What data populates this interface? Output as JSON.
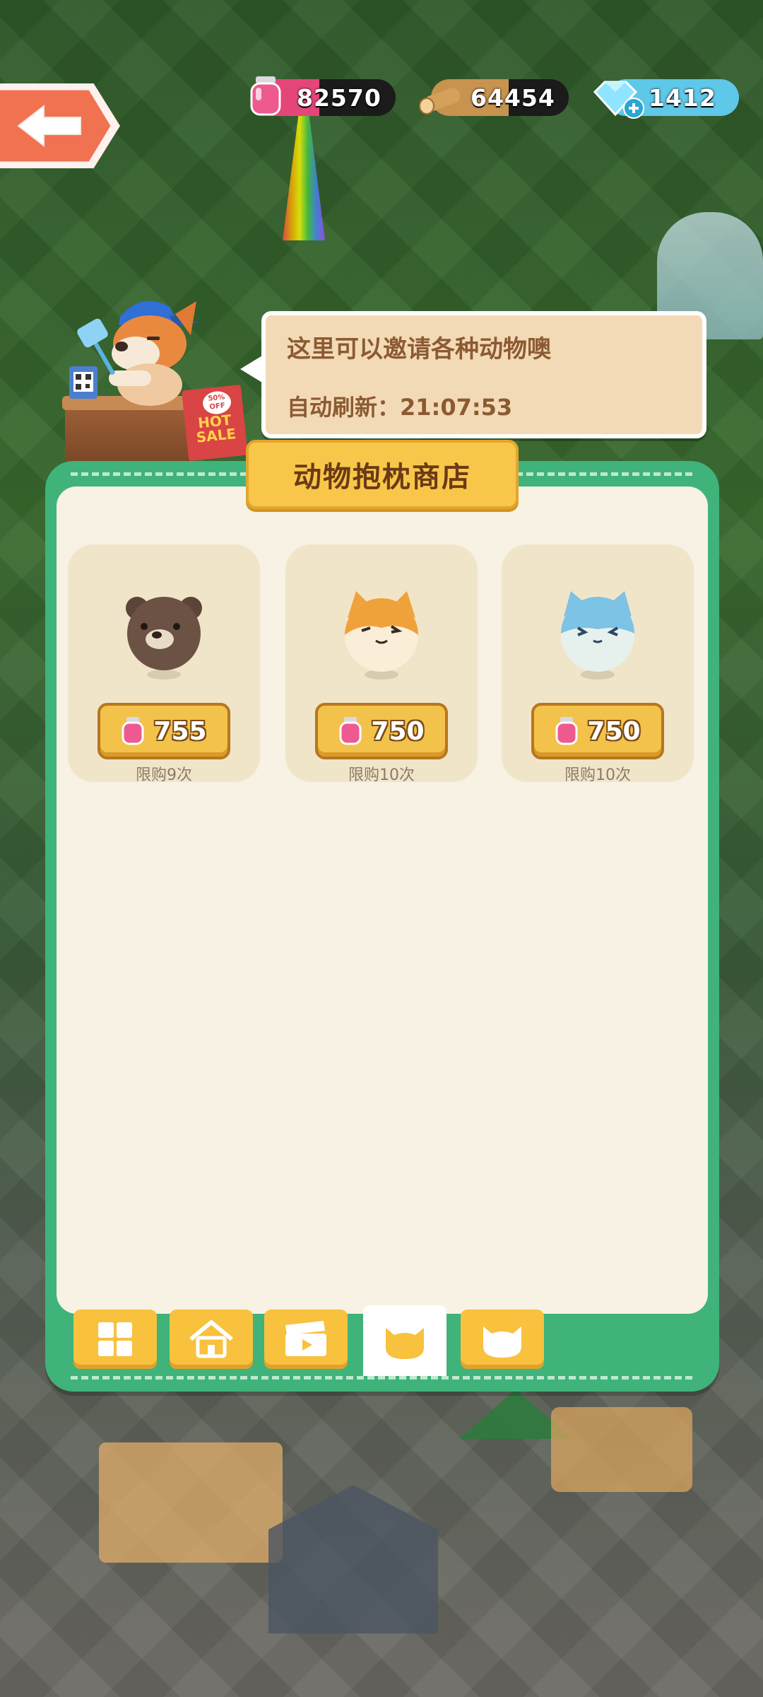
{
  "resources": {
    "ink": "82570",
    "wood": "64454",
    "gems": "1412"
  },
  "npc": {
    "sale_badge": "50% OFF",
    "sale_sign_line1": "HOT",
    "sale_sign_line2": "SALE"
  },
  "bubble": {
    "message": "这里可以邀请各种动物噢",
    "refresh_label": "自动刷新：21:07:53"
  },
  "shop": {
    "title": "动物抱枕商店",
    "items": [
      {
        "pillow": "bear-pillow",
        "price": "755",
        "limit": "限购9次"
      },
      {
        "pillow": "shiba-pillow",
        "price": "750",
        "limit": "限购10次"
      },
      {
        "pillow": "blue-cat-pillow",
        "price": "750",
        "limit": "限购10次"
      }
    ]
  },
  "tabs": [
    {
      "icon": "grid-icon",
      "active": false
    },
    {
      "icon": "house-icon",
      "active": false
    },
    {
      "icon": "clapperboard-icon",
      "active": false
    },
    {
      "icon": "cat-face-icon",
      "active": true
    },
    {
      "icon": "cat-face-outline-icon",
      "active": false
    }
  ],
  "colors": {
    "panel_green": "#3fb37a",
    "panel_cream": "#f7f2e3",
    "title_yellow": "#f8c74a",
    "price_yellow": "#f2c24a",
    "bubble_tan": "#f3dab7",
    "back_orange": "#f07250",
    "ink_pink": "#e5467a",
    "gem_blue": "#5fc7e8"
  }
}
